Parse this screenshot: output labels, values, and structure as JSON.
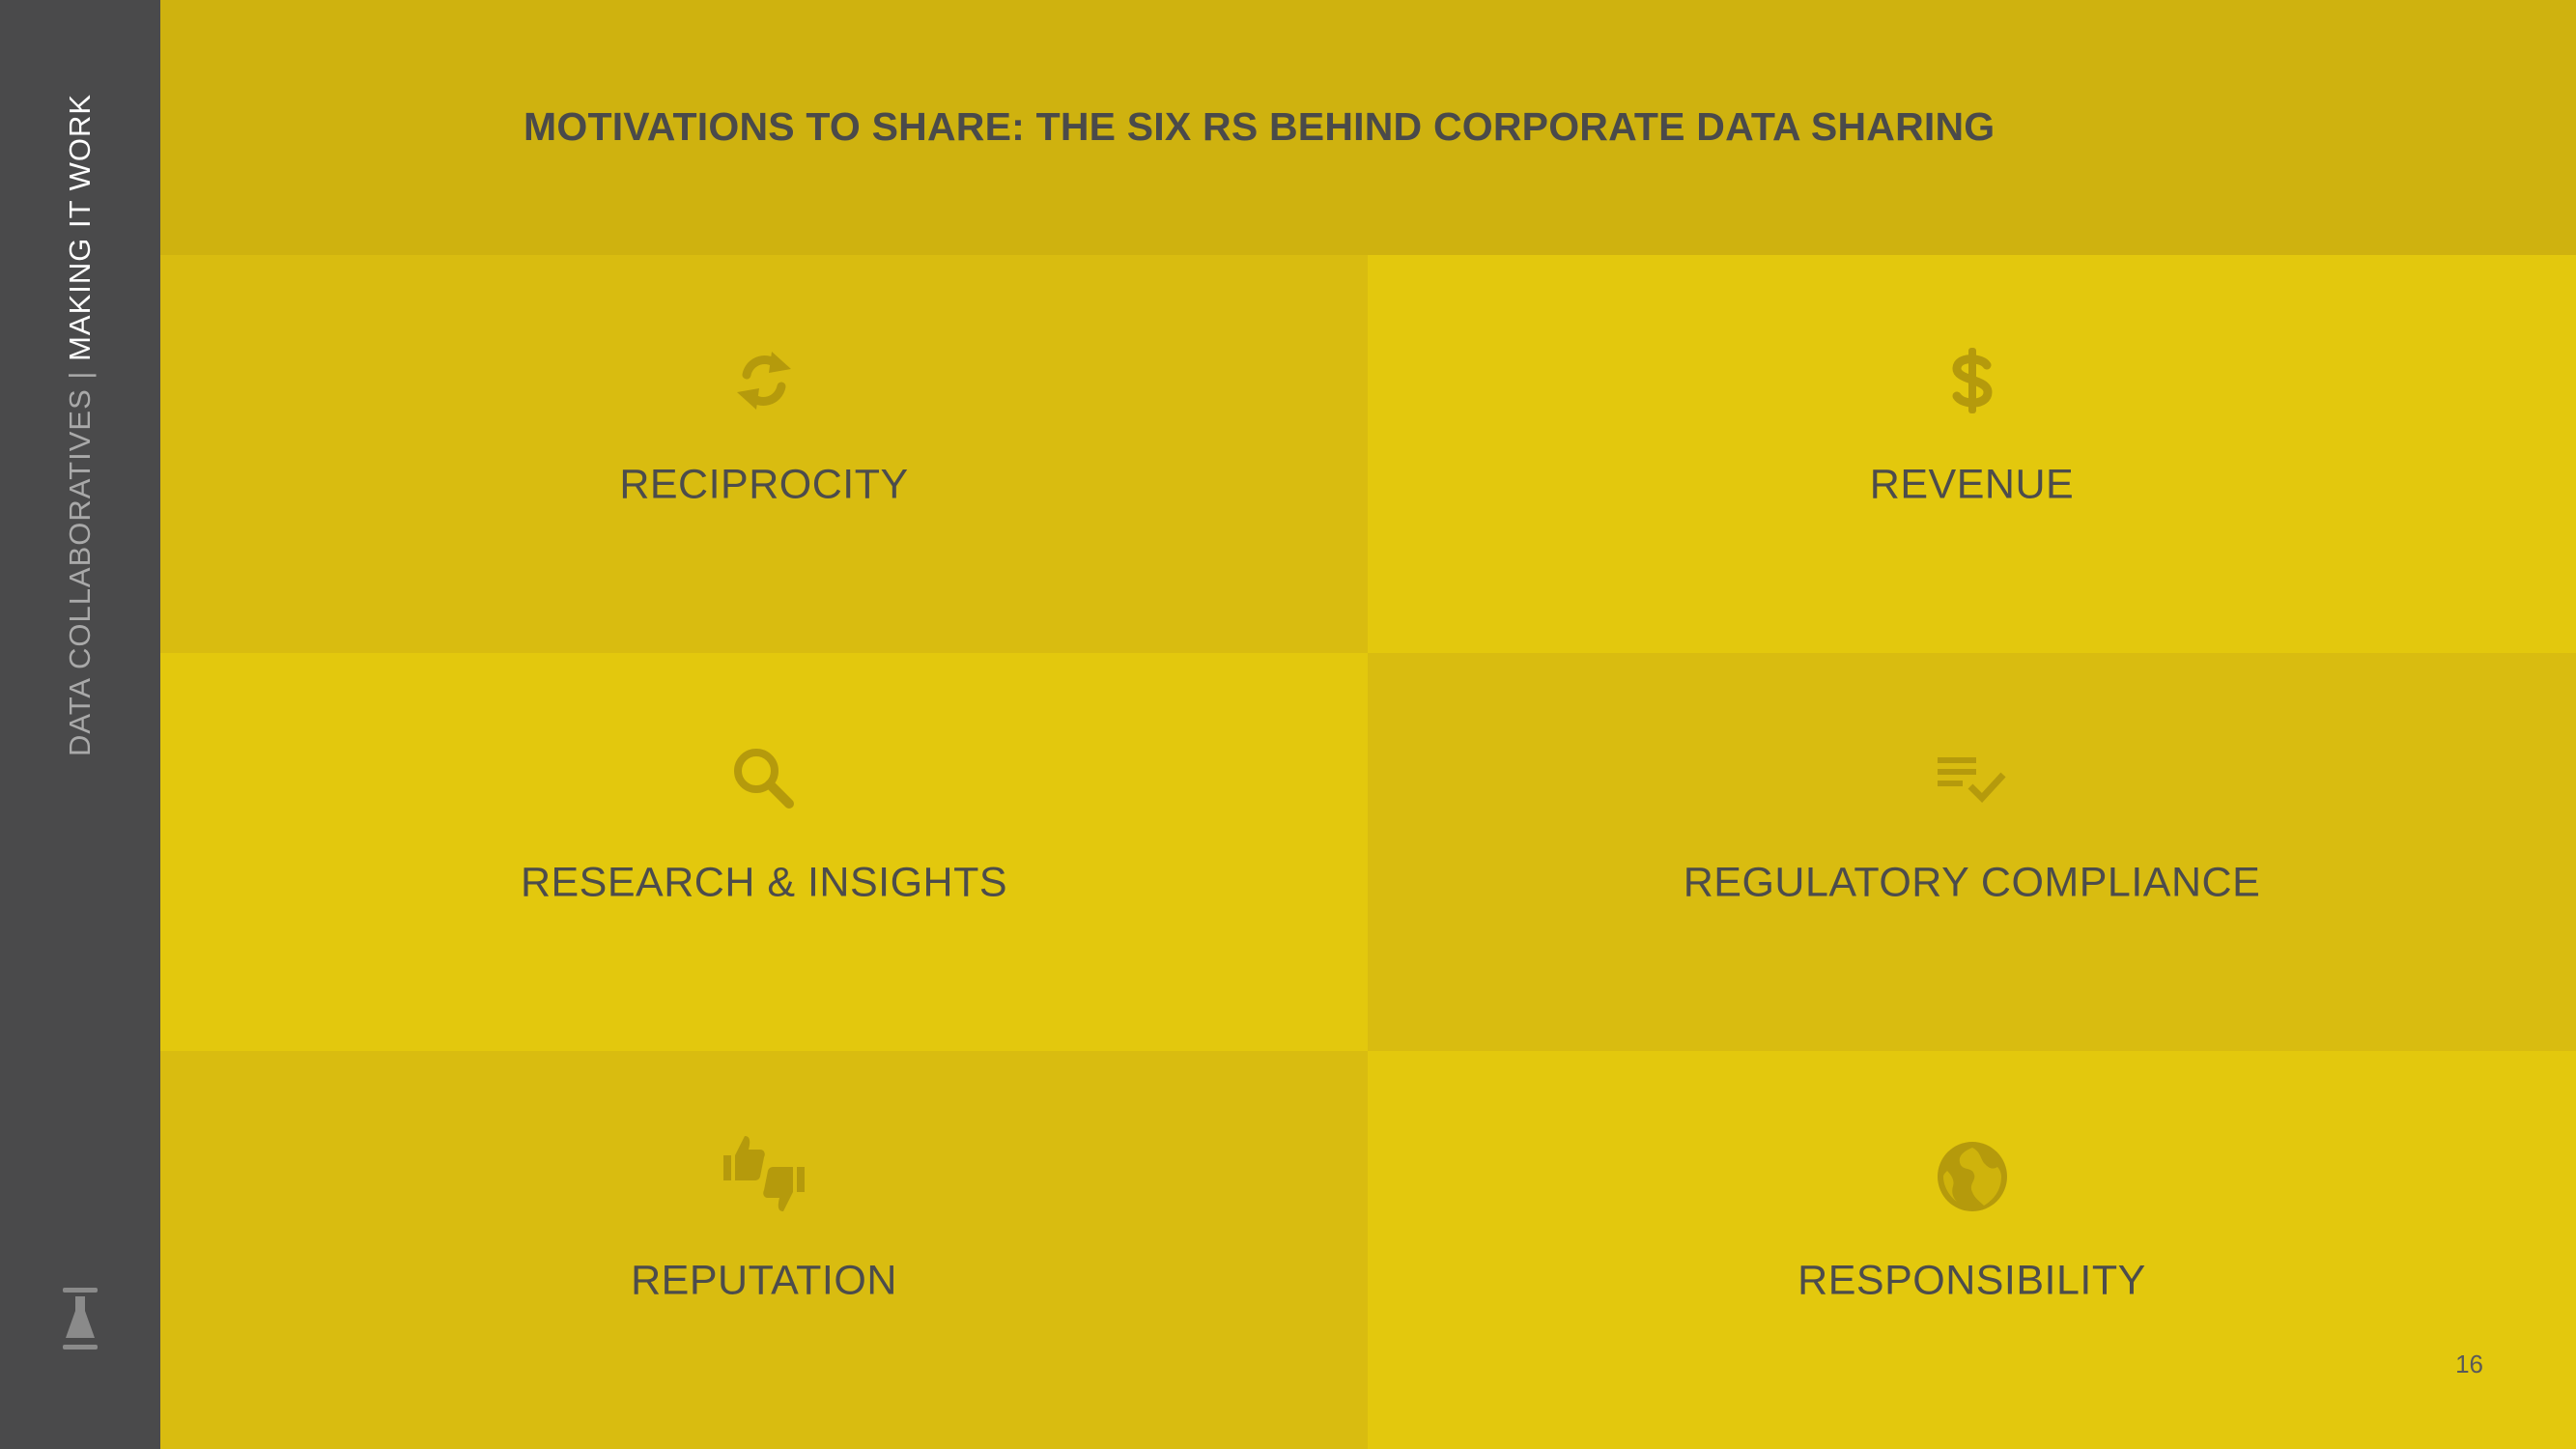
{
  "sidebar": {
    "running_title_part1": "DATA COLLABORATIVES",
    "separator": "|",
    "running_title_part2": "MAKING IT WORK",
    "logo_icon": "flask-icon"
  },
  "header": {
    "title": "MOTIVATIONS TO SHARE: THE SIX RS BEHIND CORPORATE DATA SHARING"
  },
  "motivations": [
    {
      "label": "RECIPROCITY",
      "icon": "refresh-icon"
    },
    {
      "label": "REVENUE",
      "icon": "dollar-icon"
    },
    {
      "label": "RESEARCH & INSIGHTS",
      "icon": "search-icon"
    },
    {
      "label": "REGULATORY COMPLIANCE",
      "icon": "checklist-icon"
    },
    {
      "label": "REPUTATION",
      "icon": "thumbs-up-down-icon"
    },
    {
      "label": "RESPONSIBILITY",
      "icon": "globe-icon"
    }
  ],
  "colors": {
    "sidebar": "#4a4a4b",
    "header": "#cfb20f",
    "cell_dark": "#d9bc10",
    "cell_light": "#e3c80d",
    "icon": "#b59a0c",
    "text": "#4c4c4c"
  },
  "page_number": "16"
}
